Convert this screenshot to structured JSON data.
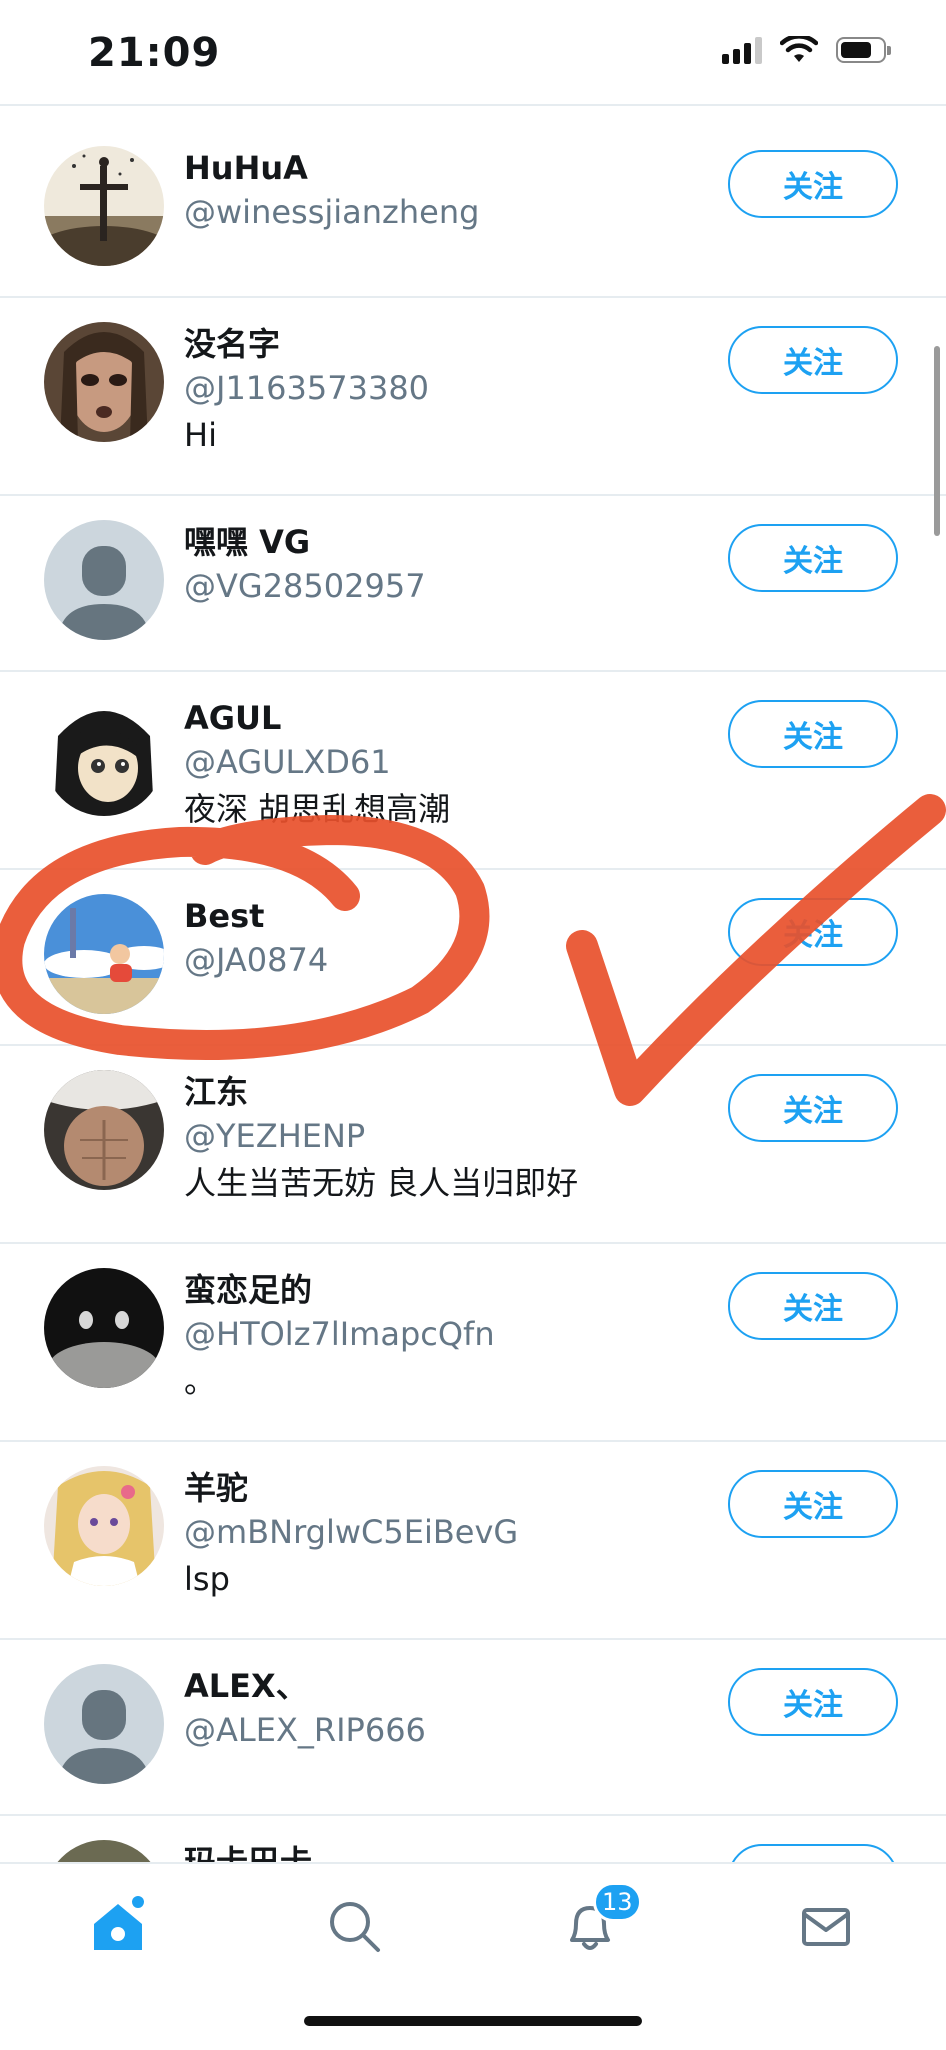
{
  "status_bar": {
    "time": "21:09"
  },
  "follow_label": "关注",
  "users": [
    {
      "name": "HuHuA",
      "handle": "@winessjianzheng",
      "bio": ""
    },
    {
      "name": "没名字",
      "handle": "@J1163573380",
      "bio": "Hi"
    },
    {
      "name": "嘿嘿 VG",
      "handle": "@VG28502957",
      "bio": ""
    },
    {
      "name": "AGUL",
      "handle": "@AGULXD61",
      "bio": "夜深 胡思乱想高潮"
    },
    {
      "name": "Best",
      "handle": "@JA0874",
      "bio": ""
    },
    {
      "name": "江东",
      "handle": "@YEZHENP",
      "bio": "人生当苦无妨 良人当归即好"
    },
    {
      "name": "蛮恋足的",
      "handle": "@HTOlz7lImapcQfn",
      "bio": "。"
    },
    {
      "name": "羊驼",
      "handle": "@mBNrglwC5EiBevG",
      "bio": "lsp"
    },
    {
      "name": "ALEX、",
      "handle": "@ALEX_RIP666",
      "bio": ""
    },
    {
      "name": "玛卡巴卡",
      "handle": "",
      "bio": ""
    }
  ],
  "tab_bar": {
    "tabs": [
      {
        "icon": "home-icon",
        "active": true
      },
      {
        "icon": "search-icon",
        "active": false
      },
      {
        "icon": "bell-icon",
        "active": false
      },
      {
        "icon": "mail-icon",
        "active": false
      }
    ],
    "notification_count": "13"
  },
  "colors": {
    "accent": "#1da1f2",
    "annotation": "#e8502b",
    "secondary_text": "#657786"
  }
}
